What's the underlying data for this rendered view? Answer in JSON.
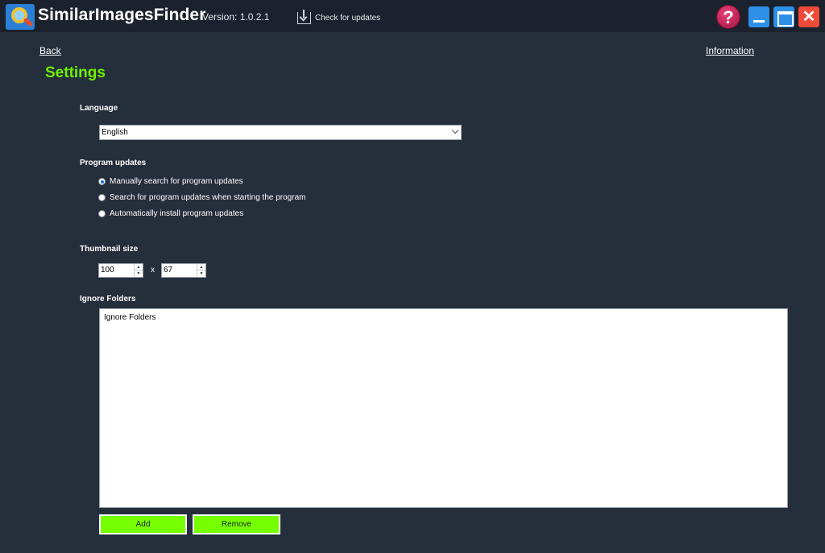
{
  "titlebar": {
    "app_name": "SimilarImagesFinder",
    "version": "Version: 1.0.2.1",
    "check_updates": "Check for updates",
    "help_symbol": "?",
    "close_symbol": "✕"
  },
  "nav": {
    "back": "Back",
    "information": "Information"
  },
  "page": {
    "title": "Settings"
  },
  "language": {
    "label": "Language",
    "selected": "English"
  },
  "updates": {
    "label": "Program updates",
    "options": [
      {
        "label": "Manually search for program updates",
        "checked": true
      },
      {
        "label": "Search for program updates when starting the program",
        "checked": false
      },
      {
        "label": "Automatically install program updates",
        "checked": false
      }
    ]
  },
  "thumbnail": {
    "label": "Thumbnail size",
    "width": "100",
    "height": "67",
    "separator": "x"
  },
  "ignore_folders": {
    "label": "Ignore Folders",
    "list_placeholder": "Ignore Folders",
    "add_label": "Add",
    "remove_label": "Remove"
  },
  "colors": {
    "background": "#252e3b",
    "titlebar": "#1b222d",
    "accent_green": "#76ff00",
    "title_green": "#6ff000"
  }
}
